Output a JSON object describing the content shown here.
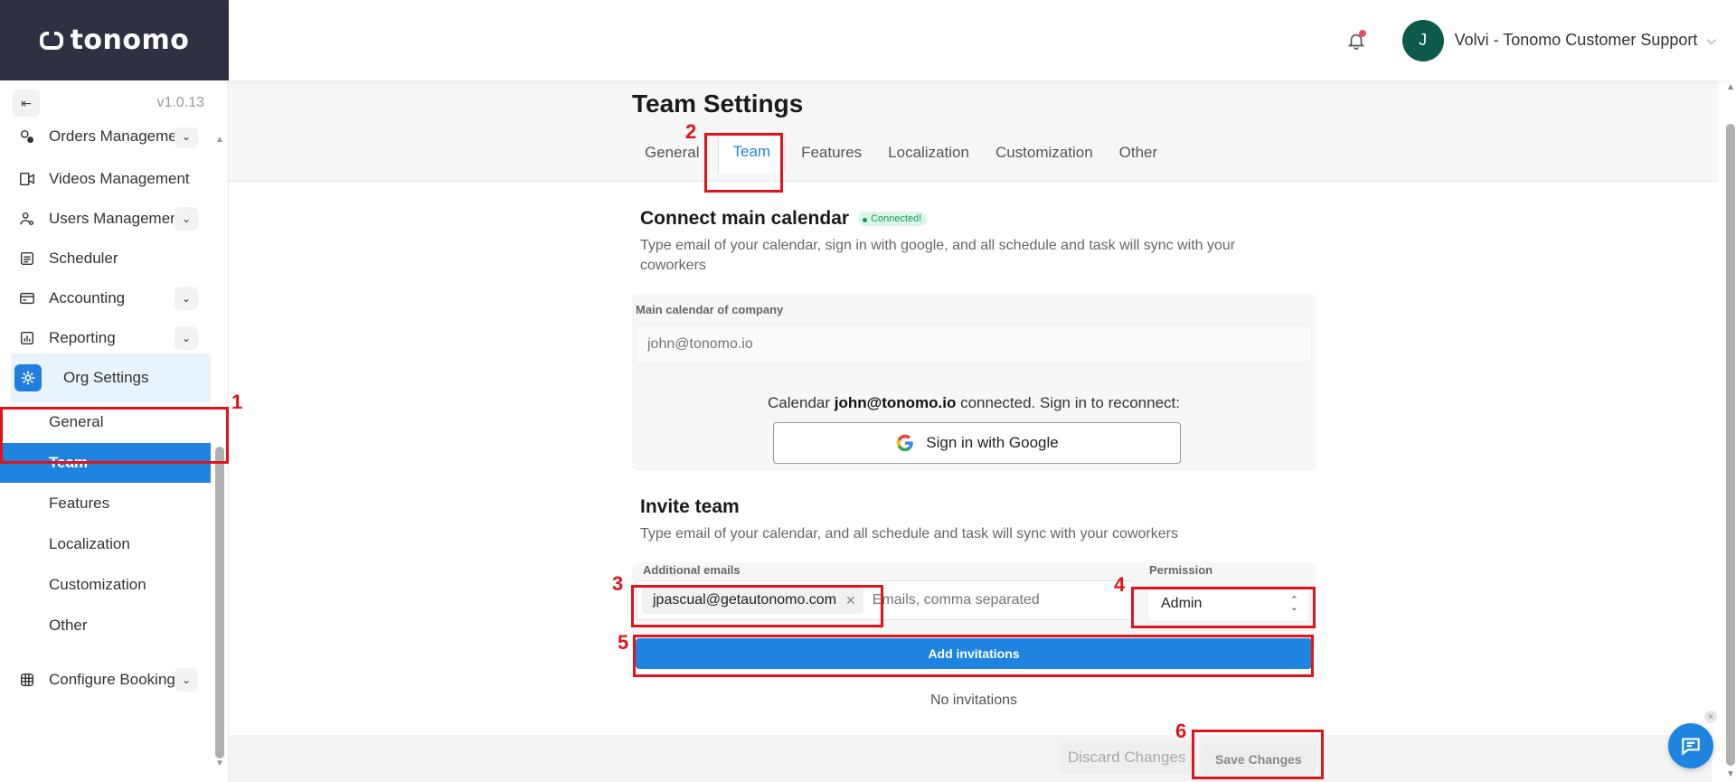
{
  "app": {
    "logo": "tonomo",
    "version": "v1.0.13"
  },
  "header": {
    "user_initial": "J",
    "user_name": "Volvi - Tonomo Customer Support",
    "notification_dot_color": "#ef4d6b"
  },
  "sidebar": {
    "items": [
      {
        "label": "Orders Manageme",
        "icon": "orders-icon",
        "expandable": true
      },
      {
        "label": "Videos Management",
        "icon": "video-icon",
        "expandable": false
      },
      {
        "label": "Users Managemen",
        "icon": "users-icon",
        "expandable": true
      },
      {
        "label": "Scheduler",
        "icon": "calendar-icon",
        "expandable": false
      },
      {
        "label": "Accounting",
        "icon": "wallet-icon",
        "expandable": true
      },
      {
        "label": "Reporting",
        "icon": "chart-icon",
        "expandable": true
      },
      {
        "label": "Org Settings",
        "icon": "gear-icon",
        "expandable": false,
        "active": true
      },
      {
        "label": "Configure Booking",
        "icon": "grid-icon",
        "expandable": true
      }
    ],
    "org_settings_children": [
      "General",
      "Team",
      "Features",
      "Localization",
      "Customization",
      "Other"
    ],
    "selected_child": "Team"
  },
  "page": {
    "title": "Team Settings",
    "tabs": [
      "General",
      "Team",
      "Features",
      "Localization",
      "Customization",
      "Other"
    ],
    "active_tab": "Team"
  },
  "calendar": {
    "title": "Connect main calendar",
    "badge": "Connected!",
    "description": "Type email of your calendar, sign in with google, and all schedule and task will sync with your coworkers",
    "field_label": "Main calendar of company",
    "placeholder": "john@tonomo.io",
    "status_prefix": "Calendar ",
    "status_email": "john@tonomo.io",
    "status_suffix": " connected. Sign in to reconnect:",
    "google_button": "Sign in with Google"
  },
  "invite": {
    "title": "Invite team",
    "description": "Type email of your calendar, and all schedule and task will sync with your coworkers",
    "emails_label": "Additional emails",
    "chip": "jpascual@getautonomo.com",
    "emails_placeholder": "Emails, comma separated",
    "permission_label": "Permission",
    "permission_value": "Admin",
    "add_button": "Add invitations",
    "empty_text": "No invitations"
  },
  "footer": {
    "discard": "Discard Changes",
    "save": "Save Changes"
  },
  "annotations": [
    "1",
    "2",
    "3",
    "4",
    "5",
    "6"
  ],
  "colors": {
    "accent": "#1f84e0",
    "annotation": "#e0141a",
    "sidebar_dark": "#2d3142"
  }
}
